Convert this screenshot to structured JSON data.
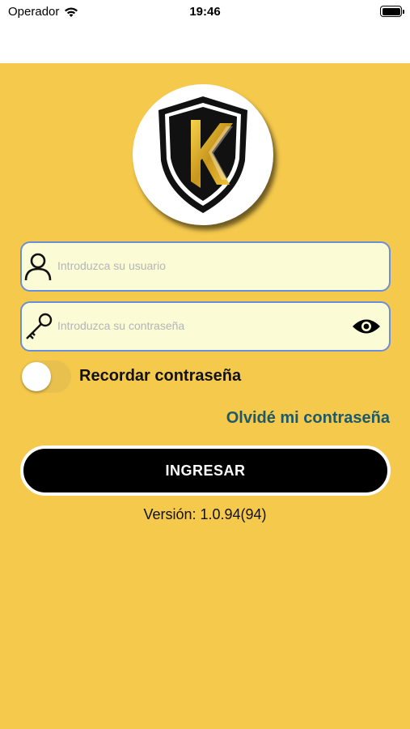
{
  "status_bar": {
    "carrier": "Operador",
    "time": "19:46",
    "battery_level": 1.0
  },
  "login": {
    "username_placeholder": "Introduzca su usuario",
    "password_placeholder": "Introduzca su contraseña",
    "remember_label": "Recordar contraseña",
    "remember_on": false,
    "forgot_label": "Olvidé mi contraseña",
    "submit_label": "INGRESAR",
    "version": "Versión: 1.0.94(94)"
  },
  "colors": {
    "background": "#f5c94c",
    "field_bg": "#fbfbd6",
    "field_border": "#6b8fd6",
    "link": "#1c5a6b",
    "button": "#000000"
  },
  "icons": {
    "username": "user-icon",
    "password": "key-icon",
    "show_password": "eye-icon",
    "logo": "shield-k-logo"
  }
}
